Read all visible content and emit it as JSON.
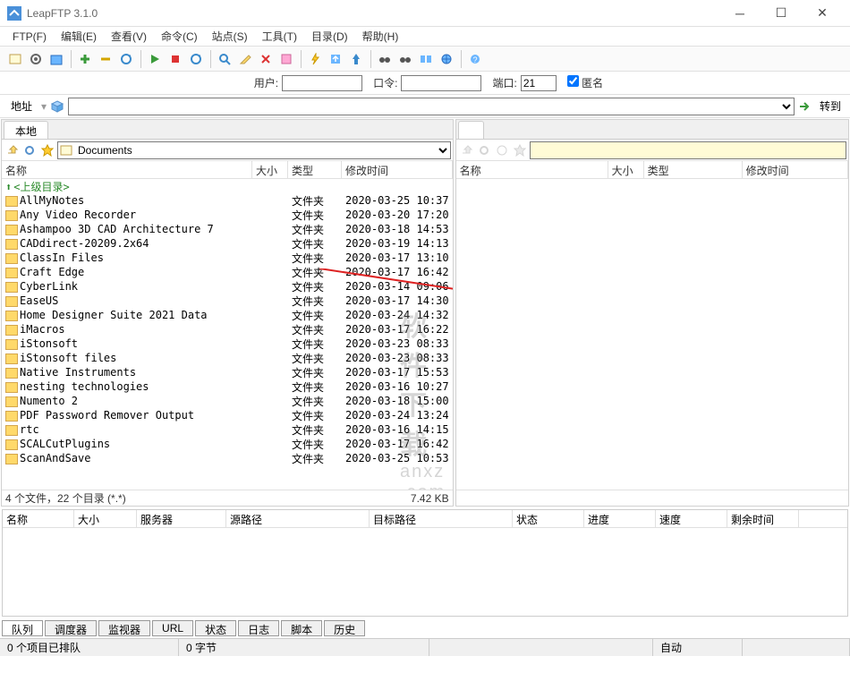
{
  "title": "LeapFTP 3.1.0",
  "menu": [
    "FTP(F)",
    "编辑(E)",
    "查看(V)",
    "命令(C)",
    "站点(S)",
    "工具(T)",
    "目录(D)",
    "帮助(H)"
  ],
  "conn": {
    "user_label": "用户:",
    "user_value": "",
    "pass_label": "口令:",
    "pass_value": "",
    "port_label": "端口:",
    "port_value": "21",
    "anon_label": "匿名"
  },
  "addr": {
    "label": "地址",
    "go": "转到"
  },
  "local": {
    "tab": "本地",
    "path": "Documents",
    "cols": {
      "name": "名称",
      "size": "大小",
      "type": "类型",
      "date": "修改时间"
    },
    "up_row": "<上级目录>",
    "rows": [
      {
        "name": "AllMyNotes",
        "type": "文件夹",
        "date": "2020-03-25 10:37"
      },
      {
        "name": "Any Video Recorder",
        "type": "文件夹",
        "date": "2020-03-20 17:20"
      },
      {
        "name": "Ashampoo 3D CAD Architecture 7",
        "type": "文件夹",
        "date": "2020-03-18 14:53"
      },
      {
        "name": "CADdirect-20209.2x64",
        "type": "文件夹",
        "date": "2020-03-19 14:13"
      },
      {
        "name": "ClassIn Files",
        "type": "文件夹",
        "date": "2020-03-17 13:10"
      },
      {
        "name": "Craft Edge",
        "type": "文件夹",
        "date": "2020-03-17 16:42"
      },
      {
        "name": "CyberLink",
        "type": "文件夹",
        "date": "2020-03-14 09:06"
      },
      {
        "name": "EaseUS",
        "type": "文件夹",
        "date": "2020-03-17 14:30"
      },
      {
        "name": "Home Designer Suite 2021 Data",
        "type": "文件夹",
        "date": "2020-03-24 14:32"
      },
      {
        "name": "iMacros",
        "type": "文件夹",
        "date": "2020-03-17 16:22"
      },
      {
        "name": "iStonsoft",
        "type": "文件夹",
        "date": "2020-03-23 08:33"
      },
      {
        "name": "iStonsoft files",
        "type": "文件夹",
        "date": "2020-03-23 08:33"
      },
      {
        "name": "Native Instruments",
        "type": "文件夹",
        "date": "2020-03-17 15:53"
      },
      {
        "name": "nesting technologies",
        "type": "文件夹",
        "date": "2020-03-16 10:27"
      },
      {
        "name": "Numento 2",
        "type": "文件夹",
        "date": "2020-03-18 15:00"
      },
      {
        "name": "PDF Password Remover Output",
        "type": "文件夹",
        "date": "2020-03-24 13:24"
      },
      {
        "name": "rtc",
        "type": "文件夹",
        "date": "2020-03-16 14:15"
      },
      {
        "name": "SCALCutPlugins",
        "type": "文件夹",
        "date": "2020-03-17 16:42"
      },
      {
        "name": "ScanAndSave",
        "type": "文件夹",
        "date": "2020-03-25 10:53"
      }
    ],
    "status_left": "4 个文件，22 个目录 (*.*)",
    "status_right": "7.42 KB"
  },
  "remote": {
    "cols": {
      "name": "名称",
      "size": "大小",
      "type": "类型",
      "date": "修改时间"
    }
  },
  "queue": {
    "cols": [
      "名称",
      "大小",
      "服务器",
      "源路径",
      "目标路径",
      "状态",
      "进度",
      "速度",
      "剩余时间"
    ]
  },
  "bottom_tabs": [
    "队列",
    "调度器",
    "监视器",
    "URL",
    "状态",
    "日志",
    "脚本",
    "历史"
  ],
  "statusbar": {
    "queue": "0 个项目已排队",
    "bytes": "0 字节",
    "auto": "自动"
  },
  "watermark": {
    "line1": "软件下载",
    "line2": "anxz .com"
  }
}
